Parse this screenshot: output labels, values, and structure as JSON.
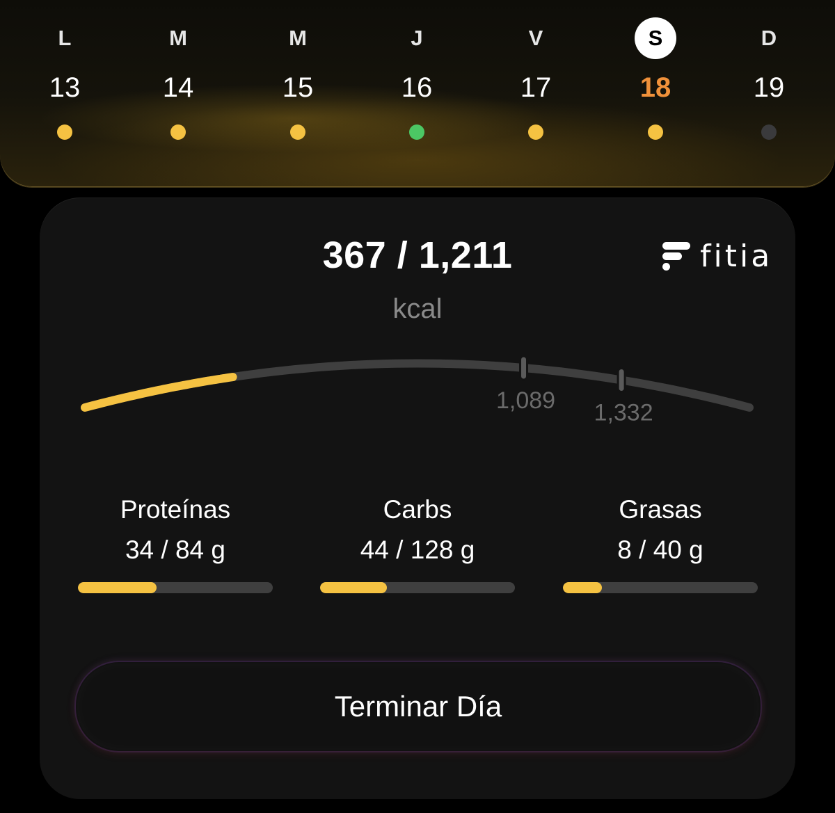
{
  "week": {
    "days": [
      {
        "letter": "L",
        "number": "13",
        "dot": "#f5c242",
        "today": false
      },
      {
        "letter": "M",
        "number": "14",
        "dot": "#f5c242",
        "today": false
      },
      {
        "letter": "M",
        "number": "15",
        "dot": "#f5c242",
        "today": false
      },
      {
        "letter": "J",
        "number": "16",
        "dot": "#4cc764",
        "today": false
      },
      {
        "letter": "V",
        "number": "17",
        "dot": "#f5c242",
        "today": false
      },
      {
        "letter": "S",
        "number": "18",
        "dot": "#f5c242",
        "today": true
      },
      {
        "letter": "D",
        "number": "19",
        "dot": "#3a3a3c",
        "today": false
      }
    ]
  },
  "summary": {
    "calories": "367 / 1,211",
    "unit": "kcal",
    "brand": "fitia",
    "consumed": 367,
    "goal": 1211,
    "range_min": 0,
    "range_max": 1650,
    "markers": [
      {
        "value": 1089,
        "label": "1,089"
      },
      {
        "value": 1332,
        "label": "1,332"
      }
    ]
  },
  "macros": [
    {
      "label": "Proteínas",
      "value": "34 / 84 g",
      "current": 34,
      "target": 84
    },
    {
      "label": "Carbs",
      "value": "44 / 128 g",
      "current": 44,
      "target": 128
    },
    {
      "label": "Grasas",
      "value": "8 / 40 g",
      "current": 8,
      "target": 40
    }
  ],
  "actions": {
    "finish_day": "Terminar Día"
  },
  "colors": {
    "accent": "#f5c242",
    "today": "#f0913a",
    "track": "#3f3f3f",
    "card": "#131313"
  }
}
